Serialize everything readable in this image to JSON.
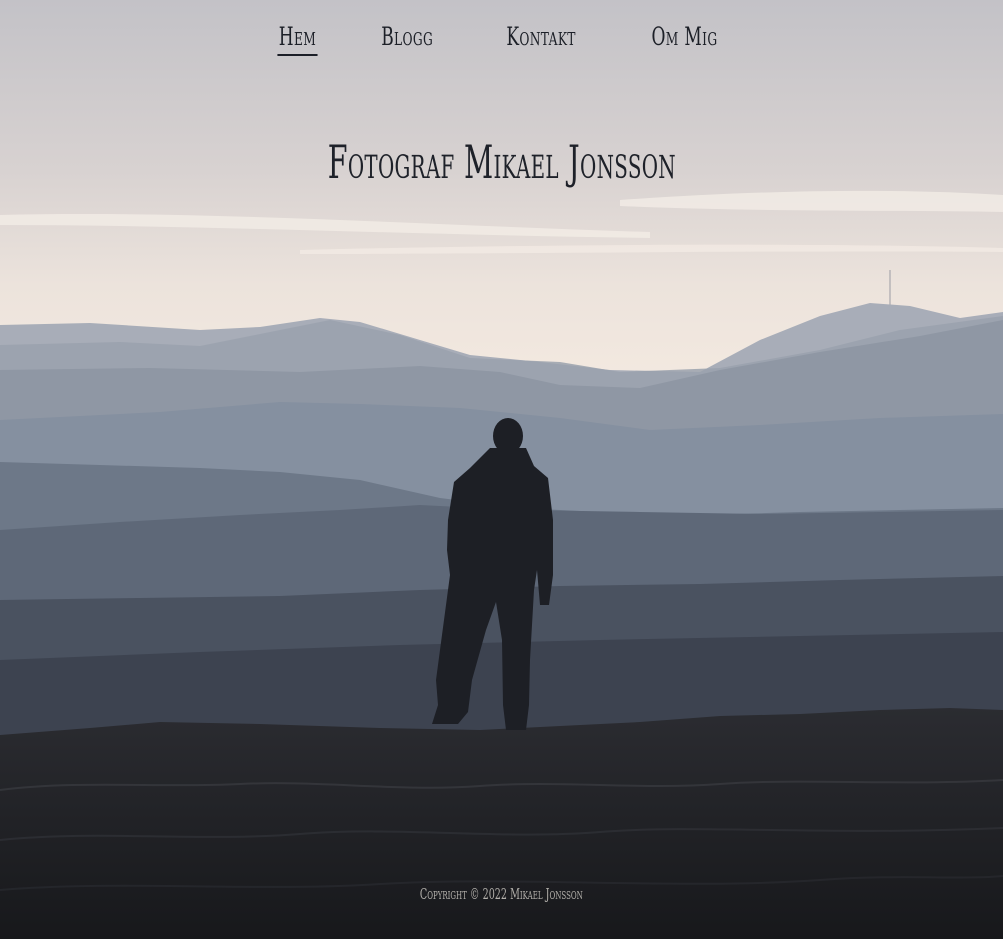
{
  "nav": {
    "items": [
      {
        "label": "Hem",
        "active": true
      },
      {
        "label": "Blogg",
        "active": false
      },
      {
        "label": "Kontakt",
        "active": false
      },
      {
        "label": "Om Mig",
        "active": false
      }
    ]
  },
  "hero": {
    "title": "Fotograf Mikael Jonsson",
    "image_subject": "silhouette-of-person-overlooking-misty-hills"
  },
  "footer": {
    "copyright": "Copyright © 2022 Mikael Jonsson"
  },
  "colors": {
    "text_dark": "#1c1f27",
    "footer_text": "#b3b0ab",
    "sky_top": "#c5c4c9",
    "sky_horizon": "#f1e6dc",
    "ground": "#1f2024"
  }
}
